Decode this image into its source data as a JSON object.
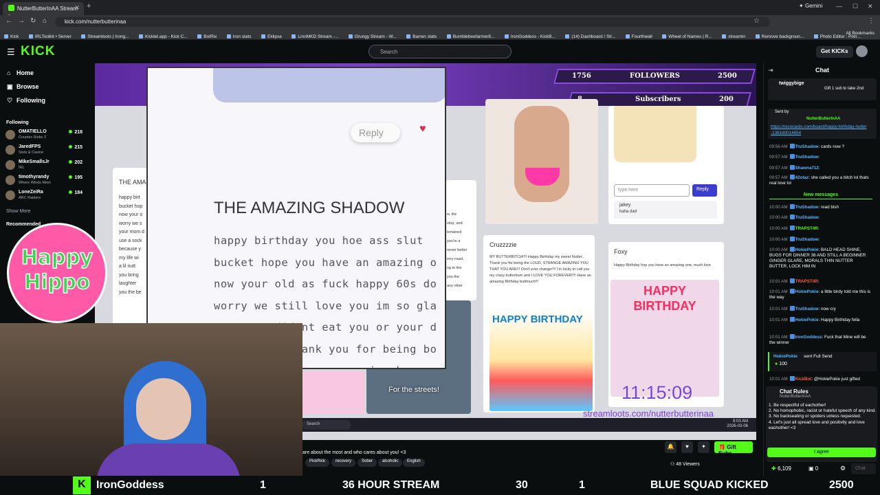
{
  "browser": {
    "tabs": [
      {
        "label": "NutterButterInAA Stream -"
      }
    ],
    "new_tab": "+",
    "gemini": "Gemini",
    "url": "kick.com/nutterbutterinaa",
    "bookmarks": [
      "Kick",
      "IRLToolkit • Server",
      "Streamloots | Irong...",
      "Kicklet.app - Kick C...",
      "BotRix",
      "Iron stats",
      "Eklipse",
      "LinnMKD Stream -...",
      "Grungy Stream - W...",
      "Barren stats",
      "Bumblebeefarmer8...",
      "IronGoddess - KickB...",
      "(14) Dashboard / Str...",
      "Fourthwall",
      "Wheel of Names | R...",
      "streamin",
      "Remove backgroun...",
      "Photo Editor : Pixlr..."
    ],
    "all_bookmarks": "All Bookmarks"
  },
  "kick": {
    "logo": "KICK",
    "search_placeholder": "Search",
    "get_kicks": "Get KICKs"
  },
  "sidebar": {
    "nav": [
      {
        "icon": "⌂",
        "label": "Home"
      },
      {
        "icon": "▣",
        "label": "Browse"
      },
      {
        "icon": "♡",
        "label": "Following"
      }
    ],
    "following_head": "Following",
    "following": [
      {
        "name": "OMATIELLO",
        "cat": "Counter-Strike 2",
        "viewers": "218"
      },
      {
        "name": "JaredFPS",
        "cat": "Slots & Casino",
        "viewers": "215"
      },
      {
        "name": "MikeSmallsJr",
        "cat": "IRL",
        "viewers": "202"
      },
      {
        "name": "timothyrandy",
        "cat": "Where Winds Meet",
        "viewers": "195"
      },
      {
        "name": "LoneZeiRa",
        "cat": "ARC Raiders",
        "viewers": "184"
      }
    ],
    "show_more": "Show More",
    "recommended_head": "Recommended"
  },
  "stream": {
    "followers_label": "FOLLOWERS",
    "followers_current": "1756",
    "followers_goal": "2500",
    "subs_label": "Subscribers",
    "subs_current": "8",
    "subs_goal": "200",
    "zoom_title": "THE AMAZING SHADOW",
    "zoom_body": [
      "happy birthday you hoe ass slut",
      "bucket hope you have an amazing o",
      "now your old as fuck happy 60s do",
      "worry we still love you im so gla",
      "your mom dident eat you or your d",
      "use a sock thank you for being bo",
      "because you are an amazing human"
    ],
    "zoom_reply": "Reply",
    "left_card_title": "THE AMA",
    "left_card_lines": [
      "happy birt",
      "bucket hop",
      "now your o",
      "worry we s",
      "your mom d",
      "use a sock",
      "because y",
      "my life wi",
      "a lil nutt",
      "you bring",
      "laughter",
      "you the be"
    ],
    "middle_card_lines": [
      "w, the",
      "stop, and",
      "tertained",
      "you're a",
      "never better",
      "erry roast,",
      "ng to the",
      "you the",
      "any other"
    ],
    "type_here": "type here",
    "reply_btn": "Reply",
    "jakey_name": "jakey",
    "jakey_msg": "haha dad",
    "crusader_name": "Cruzzzzie",
    "crusader_msg": "MY BUTTERBITCH!!!! Happy Birthday my sweet Nutter.. Thank you for being the LOUD, STRANGE AMAZING YOU THAT YOU ARE!!! Don't ever change!!!! I'm lucky to call you my crazy butterbum and I LOVE YOU FOREVER!!!! Have an amazing Birthday buttmuch!!!",
    "crusader_img_text": "HAPPY BIRTHDAY",
    "foxy_name": "Foxy",
    "foxy_msg": "Happy Birthday hop you have an amazing one, much love",
    "foxy_img_text": "HAPPY BIRTHDAY",
    "streets_caption": "For the streets!",
    "clock": "11:15:09",
    "streamloots": "streamloots.com/nutterbutterinaa",
    "taskbar_search": "Search",
    "taskbar_time": "9:03 AM",
    "taskbar_date": "2026-03-06",
    "happy_hippo_1": "Happy",
    "happy_hippo_2": "Hippo"
  },
  "stream_info": {
    "title": "are about the most and who cares about you! <3",
    "tags": [
      "PickRick",
      "recovery",
      "Sober",
      "alcoholic",
      "English"
    ],
    "gift_subs": "Gift Subs",
    "viewers": "48 Viewers"
  },
  "bottom_bar": {
    "cam_name": "IronGoddess",
    "left_count": "1",
    "stream_label": "36 HOUR STREAM",
    "timer_small": "30",
    "mid_count": "1",
    "blue_squad": "BLUE SQUAD KICKED",
    "right_count": "2500"
  },
  "chat": {
    "title": "Chat",
    "pinned_user": "twiggybige",
    "pinned_text": "Gift 1 sub to take 2nd",
    "sent_by": "Sent by",
    "sent_user": "NutterButterInAA",
    "sent_link": "https://recocards.com/board/happy-birthday-nutter-136180014654",
    "messages": [
      {
        "t": "09:56 AM",
        "u": "TruShadow",
        "m": ": cards now ?"
      },
      {
        "t": "09:57 AM",
        "u": "TruShadow",
        "m": ":"
      },
      {
        "t": "09:57 AM",
        "u": "Shawna712",
        "m": ":"
      },
      {
        "t": "09:57 AM",
        "u": "42otaz",
        "m": ": she called you a bitch lol thats real love lol"
      },
      {
        "t": "10:00 AM",
        "u": "TruShadow",
        "m": ": read bish"
      },
      {
        "t": "10:00 AM",
        "u": "TruShadow",
        "m": ":"
      },
      {
        "t": "10:00 AM",
        "u": "TRAPST4R",
        "m": ":"
      },
      {
        "t": "10:00 AM",
        "u": "TruShadow",
        "m": ":"
      },
      {
        "t": "10:00 AM",
        "u": "HokiePokie",
        "m": ": BALD HEAD SHINE, BUGS FOR DINNER 38 AND STILL A BEGINNER GINGER GLARE, MORALS THIN NUTTER BUTTER, LOCK HIM IN"
      },
      {
        "t": "10:01 AM",
        "u": "TRAPST4R",
        "m": ":"
      },
      {
        "t": "10:01 AM",
        "u": "HokiePokie",
        "m": ": a little birdy told me this is the way"
      },
      {
        "t": "10:01 AM",
        "u": "TruShadow",
        "m": ": now cry"
      },
      {
        "t": "10:01 AM",
        "u": "HokiePokie",
        "m": ": Happy Birthday fella"
      },
      {
        "t": "10:01 AM",
        "u": "IronGoddess",
        "m": ": Fuck that Mine will be the winner"
      }
    ],
    "new_messages": "New messages",
    "gift_user": "HokiePokie",
    "gift_text": "sent Full Send",
    "gift_amount": "100",
    "last_msg": {
      "t": "10:01 AM",
      "u": "KickBot",
      "m": ": @HokiePokie just gifted"
    },
    "rules_title": "Chat Rules",
    "rules_owner": "NutterButterInAA",
    "rules_body": "1. Be respectful of eachother!\n2. No homophobic, racist or hateful speech of any kind.\n3. No backseating or spoilers unless requested.\n4. Let's just all spread love and positivity and love eachother! <3",
    "agree": "I agree",
    "kicks_count": "6,109",
    "zero_count": "0",
    "chat_input": "Chat"
  },
  "colors": {
    "kick_green": "#53fc18",
    "stream_purple": "#7b3fe4"
  }
}
